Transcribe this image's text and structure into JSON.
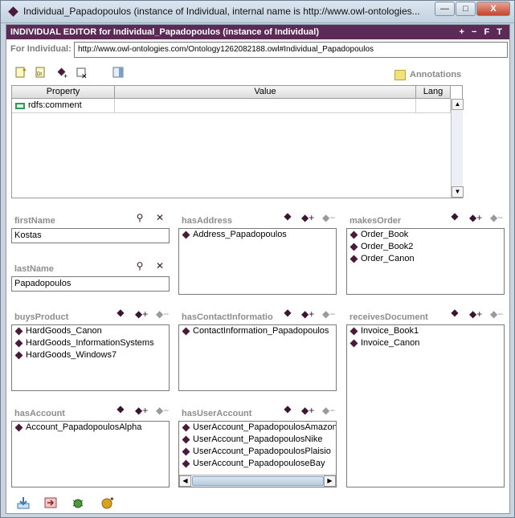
{
  "window": {
    "title": "Individual_Papadopoulos   (instance of Individual, internal name is http://www.owl-ontologies...",
    "buttons": {
      "minimize": "—",
      "maximize": "□",
      "close": "X"
    }
  },
  "editor": {
    "header": "INDIVIDUAL EDITOR for Individual_Papadopoulos   (instance of Individual)",
    "header_actions": "+ − F T",
    "for_label": "For Individual:",
    "uri": "http://www.owl-ontologies.com/Ontology1262082188.owl#Individual_Papadopoulos"
  },
  "annotations": {
    "label": "Annotations",
    "columns": [
      "Property",
      "Value",
      "Lang"
    ],
    "rows": [
      {
        "property": "rdfs:comment",
        "value": "",
        "lang": ""
      }
    ]
  },
  "slots": {
    "firstName": {
      "title": "firstName",
      "value": "Kostas"
    },
    "lastName": {
      "title": "lastName",
      "value": "Papadopoulos"
    },
    "hasAddress": {
      "title": "hasAddress",
      "items": [
        "Address_Papadopoulos"
      ]
    },
    "makesOrder": {
      "title": "makesOrder",
      "items": [
        "Order_Book",
        "Order_Book2",
        "Order_Canon"
      ]
    },
    "buysProduct": {
      "title": "buysProduct",
      "items": [
        "HardGoods_Canon",
        "HardGoods_InformationSystems",
        "HardGoods_Windows7"
      ]
    },
    "hasContactInformation": {
      "title": "hasContactInformatio",
      "items": [
        "ContactInformation_Papadopoulos"
      ]
    },
    "receivesDocument": {
      "title": "receivesDocument",
      "items": [
        "Invoice_Book1",
        "Invoice_Canon"
      ]
    },
    "hasAccount": {
      "title": "hasAccount",
      "items": [
        "Account_PapadopoulosAlpha"
      ]
    },
    "hasUserAccount": {
      "title": "hasUserAccount",
      "items": [
        "UserAccount_PapadopoulosAmazon",
        "UserAccount_PapadopoulosNike",
        "UserAccount_PapadopoulosPlaisio",
        "UserAccount_PapadopouloseBay"
      ]
    }
  }
}
